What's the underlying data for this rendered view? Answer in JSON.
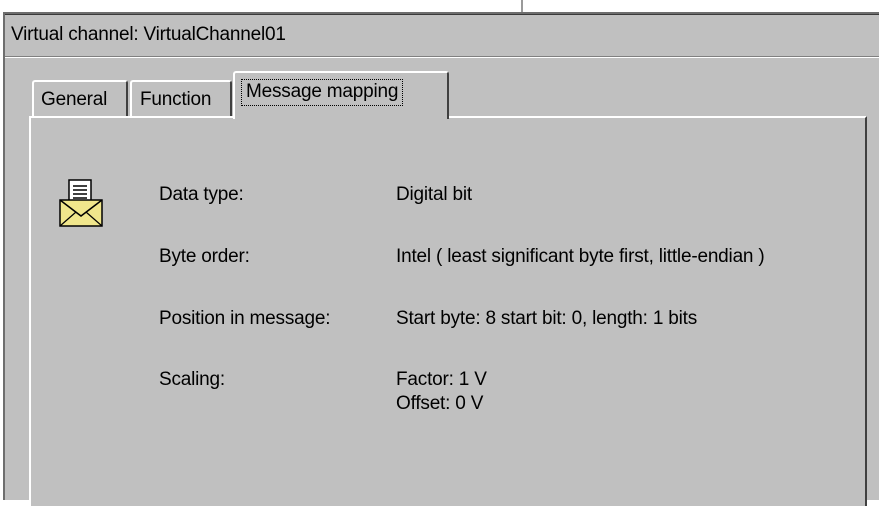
{
  "window": {
    "title": "Virtual channel: VirtualChannel01"
  },
  "tabs": [
    {
      "label": "General",
      "selected": false
    },
    {
      "label": "Function",
      "selected": false
    },
    {
      "label": "Message mapping",
      "selected": true
    }
  ],
  "icon": "envelope-document-icon",
  "properties": {
    "data_type": {
      "label": "Data type:",
      "value": "Digital bit"
    },
    "byte_order": {
      "label": "Byte order:",
      "value": "Intel ( least significant byte first, little-endian )"
    },
    "position": {
      "label": "Position in message:",
      "value": "Start byte: 8 start bit: 0, length: 1 bits"
    },
    "scaling": {
      "label": "Scaling:",
      "factor": "Factor: 1 V",
      "offset": "Offset: 0 V"
    }
  },
  "colors": {
    "face": "#c0c0c0",
    "highlight": "#ffffff",
    "shadow": "#404040",
    "envelope": "#f0e68c"
  }
}
